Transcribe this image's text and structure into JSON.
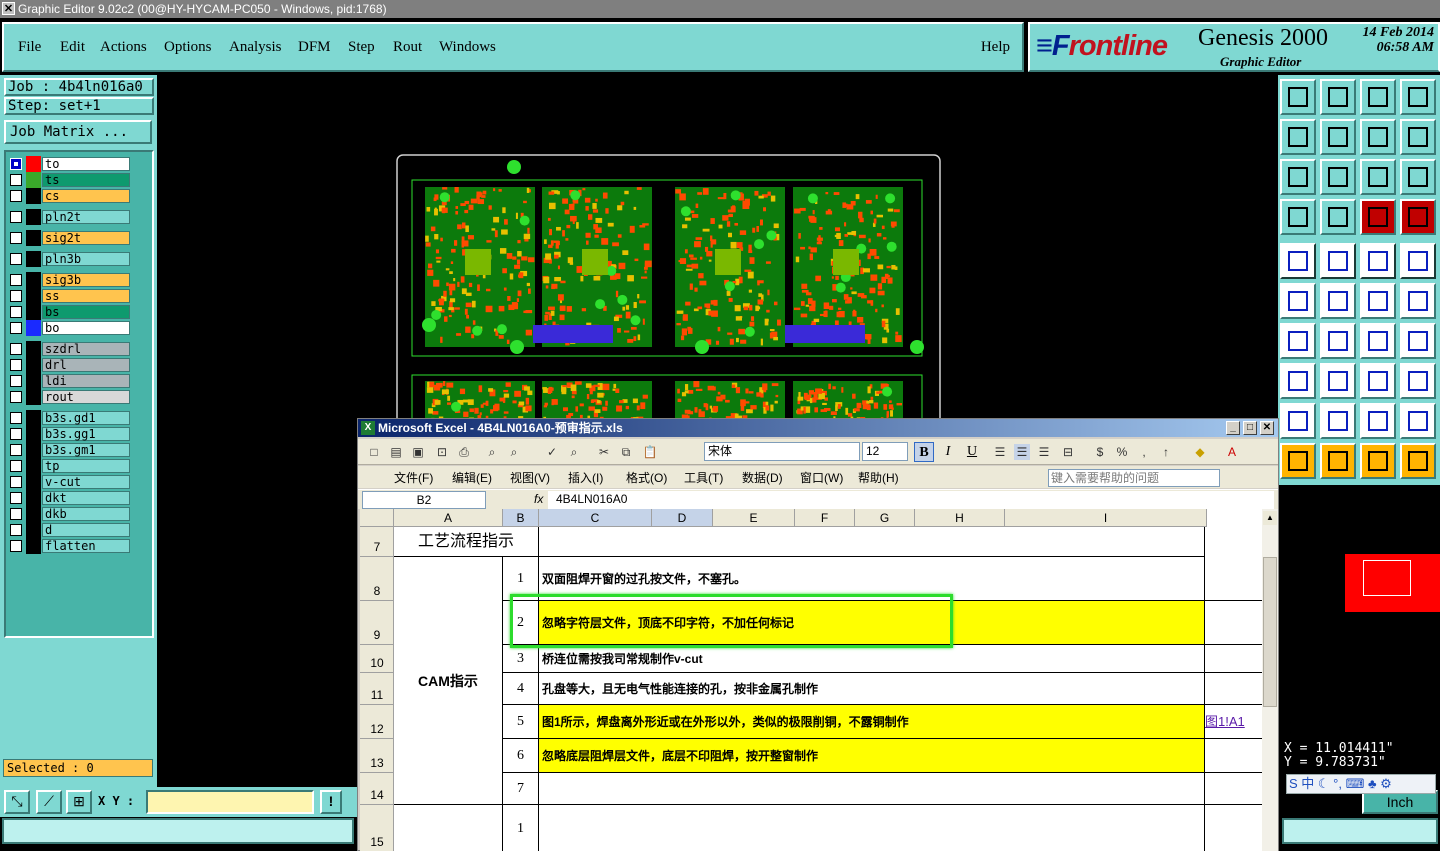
{
  "window_title": "Graphic Editor 9.02c2 (00@HY-HYCAM-PC050 - Windows, pid:1768)",
  "menu": [
    "File",
    "Edit",
    "Actions",
    "Options",
    "Analysis",
    "DFM",
    "Step",
    "Rout",
    "Windows"
  ],
  "help_label": "Help",
  "brand": {
    "logo_a": "≡F",
    "logo_b": "rontline",
    "product": "Genesis 2000",
    "subtitle": "Graphic Editor",
    "date": "14 Feb 2014",
    "time": "06:58 AM"
  },
  "job": "Job : 4b4ln016a0",
  "step": "Step: set+1",
  "job_matrix_label": "Job Matrix ...",
  "layers": [
    {
      "name": "to",
      "color": "#ffffff",
      "swatch": "#ff0000",
      "checked": true
    },
    {
      "name": "ts",
      "color": "#0e9a6e",
      "swatch": "#3aa82a",
      "checked": false
    },
    {
      "name": "cs",
      "color": "#ffc44e",
      "swatch": "#000000",
      "checked": false
    },
    {
      "name": "pln2t",
      "color": "#7fd8d2",
      "swatch": "#000000",
      "checked": false
    },
    {
      "name": "sig2t",
      "color": "#ffc44e",
      "swatch": "#000000",
      "checked": false
    },
    {
      "name": "pln3b",
      "color": "#7fd8d2",
      "swatch": "#000000",
      "checked": false
    },
    {
      "name": "sig3b",
      "color": "#ffc44e",
      "swatch": "#000000",
      "checked": false
    },
    {
      "name": "ss",
      "color": "#ffc44e",
      "swatch": "#000000",
      "checked": false
    },
    {
      "name": "bs",
      "color": "#0e9a6e",
      "swatch": "#000000",
      "checked": false
    },
    {
      "name": "bo",
      "color": "#ffffff",
      "swatch": "#1a2aff",
      "checked": false
    },
    {
      "name": "szdrl",
      "color": "#a9b4b8",
      "swatch": "#000000",
      "checked": false
    },
    {
      "name": "drl",
      "color": "#a9b4b8",
      "swatch": "#000000",
      "checked": false
    },
    {
      "name": "ldi",
      "color": "#a9b4b8",
      "swatch": "#000000",
      "checked": false
    },
    {
      "name": "rout",
      "color": "#d8d8d8",
      "swatch": "#000000",
      "checked": false
    },
    {
      "name": "b3s.gd1",
      "color": "#7fd8d2",
      "swatch": "#000000",
      "checked": false
    },
    {
      "name": "b3s.gg1",
      "color": "#7fd8d2",
      "swatch": "#000000",
      "checked": false
    },
    {
      "name": "b3s.gm1",
      "color": "#7fd8d2",
      "swatch": "#000000",
      "checked": false
    },
    {
      "name": "tp",
      "color": "#7fd8d2",
      "swatch": "#000000",
      "checked": false
    },
    {
      "name": "v-cut",
      "color": "#7fd8d2",
      "swatch": "#000000",
      "checked": false
    },
    {
      "name": "dkt",
      "color": "#7fd8d2",
      "swatch": "#000000",
      "checked": false
    },
    {
      "name": "dkb",
      "color": "#7fd8d2",
      "swatch": "#000000",
      "checked": false
    },
    {
      "name": "d",
      "color": "#7fd8d2",
      "swatch": "#000000",
      "checked": false
    },
    {
      "name": "flatten",
      "color": "#7fd8d2",
      "swatch": "#000000",
      "checked": false
    }
  ],
  "selected": "Selected : 0",
  "xy_label": "X Y :",
  "xy_value": "",
  "coords": {
    "x": "X = 11.014411\"",
    "y": "Y = 9.783731\""
  },
  "units": "Inch",
  "ime": "S 中 ☾ °, ⌨ ♣ ⚙",
  "excel": {
    "title": "Microsoft Excel - 4B4LN016A0-预审指示.xls",
    "font": "宋体",
    "size": "12",
    "menu": [
      "文件(F)",
      "编辑(E)",
      "视图(V)",
      "插入(I)",
      "格式(O)",
      "工具(T)",
      "数据(D)",
      "窗口(W)",
      "帮助(H)"
    ],
    "help_placeholder": "键入需要帮助的问题",
    "name_box": "B2",
    "formula": "4B4LN016A0",
    "columns": [
      "A",
      "B",
      "C",
      "D",
      "E",
      "F",
      "G",
      "H",
      "I"
    ],
    "section_title": "工艺流程指示",
    "section_label": "CAM指示",
    "rows": [
      {
        "row": "7"
      },
      {
        "row": "8",
        "num": "1",
        "text": "双面阻焊开窗的过孔按文件，不塞孔。",
        "yellow": false
      },
      {
        "row": "9",
        "num": "2",
        "text": "忽略字符层文件，顶底不印字符，不加任何标记",
        "yellow": true
      },
      {
        "row": "10",
        "num": "3",
        "text": "桥连位需按我司常规制作v-cut",
        "yellow": false
      },
      {
        "row": "11",
        "num": "4",
        "text": "孔盘等大，且无电气性能连接的孔，按非金属孔制作",
        "yellow": false
      },
      {
        "row": "12",
        "num": "5",
        "text": "图1所示，焊盘离外形近或在外形以外，类似的极限削铜，不露铜制作",
        "yellow": true,
        "link": "图1!A1"
      },
      {
        "row": "13",
        "num": "6",
        "text": "忽略底层阻焊层文件，底层不印阻焊，按开整窗制作",
        "yellow": true
      },
      {
        "row": "14",
        "num": "7",
        "text": "",
        "yellow": false
      },
      {
        "row": "15",
        "num": "1",
        "text": "",
        "yellow": false
      }
    ]
  }
}
